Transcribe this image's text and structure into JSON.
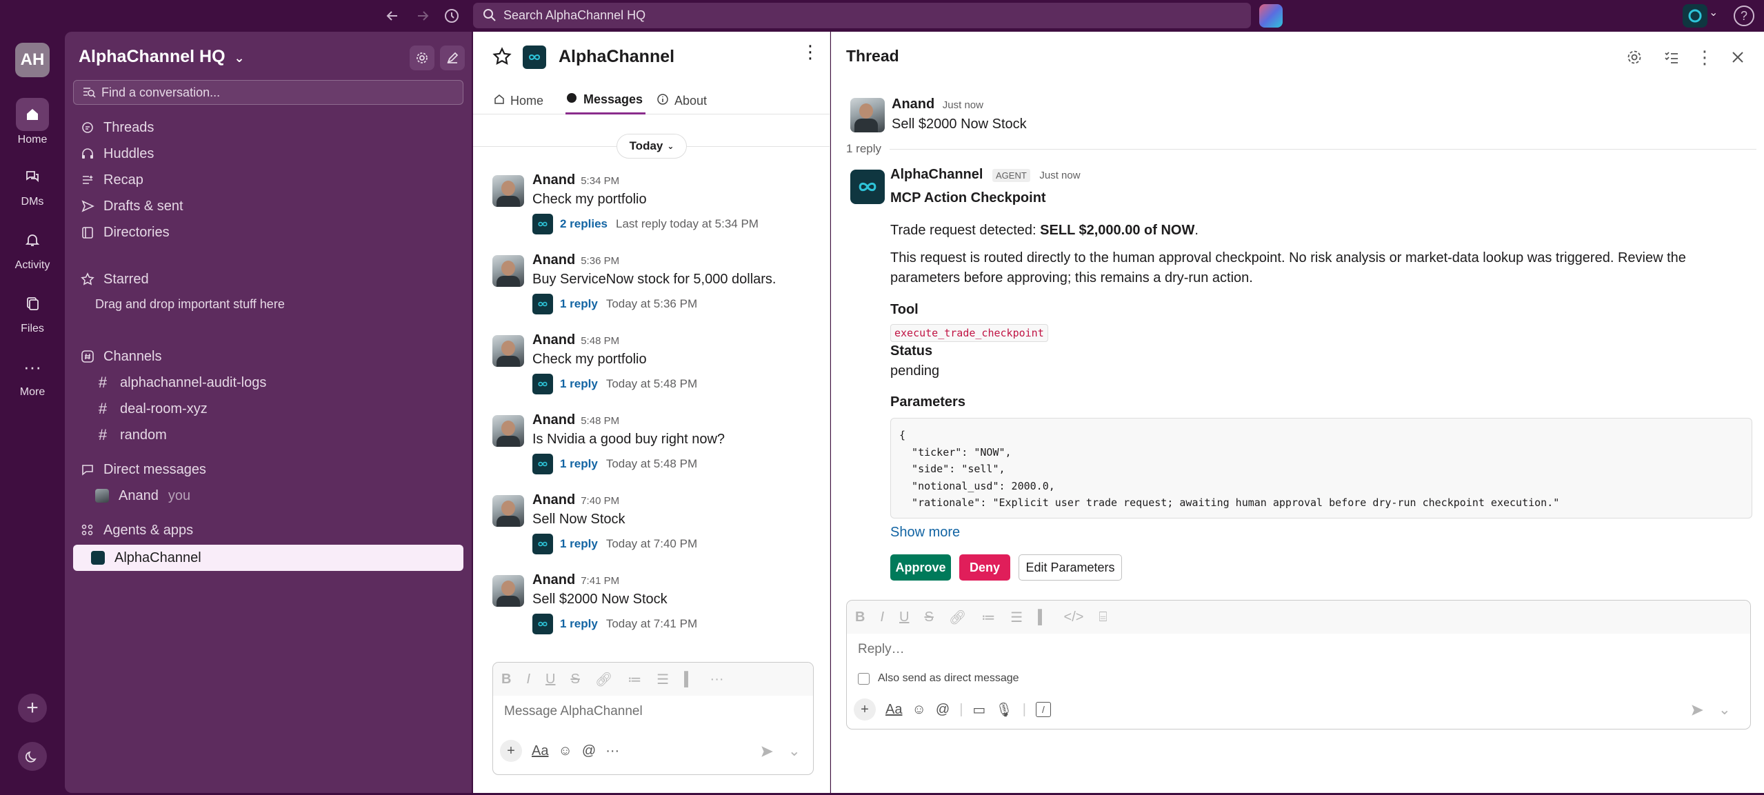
{
  "topbar": {
    "search_placeholder": "Search AlphaChannel HQ"
  },
  "rail": {
    "workspace_initials": "AH",
    "items": [
      {
        "label": "Home"
      },
      {
        "label": "DMs"
      },
      {
        "label": "Activity"
      },
      {
        "label": "Files"
      },
      {
        "label": "More"
      }
    ]
  },
  "sidebar": {
    "workspace_name": "AlphaChannel HQ",
    "find_placeholder": "Find a conversation...",
    "nav": [
      "Threads",
      "Huddles",
      "Recap",
      "Drafts & sent",
      "Directories"
    ],
    "starred_header": "Starred",
    "starred_hint": "Drag and drop important stuff here",
    "channels_header": "Channels",
    "channels": [
      "alphachannel-audit-logs",
      "deal-room-xyz",
      "random"
    ],
    "dm_header": "Direct messages",
    "dm_user": "Anand",
    "dm_you": "you",
    "apps_header": "Agents & apps",
    "active_app": "AlphaChannel"
  },
  "channel": {
    "title": "AlphaChannel",
    "tabs": [
      "Home",
      "Messages",
      "About"
    ],
    "date_pill": "Today",
    "messages": [
      {
        "name": "Anand",
        "time": "5:34 PM",
        "text": "Check my portfolio",
        "replies": "2 replies",
        "reply_meta": "Last reply today at 5:34 PM"
      },
      {
        "name": "Anand",
        "time": "5:36 PM",
        "text": "Buy ServiceNow stock for 5,000 dollars.",
        "replies": "1 reply",
        "reply_meta": "Today at 5:36 PM"
      },
      {
        "name": "Anand",
        "time": "5:48 PM",
        "text": "Check my portfolio",
        "replies": "1 reply",
        "reply_meta": "Today at 5:48 PM"
      },
      {
        "name": "Anand",
        "time": "5:48 PM",
        "text": "Is Nvidia a good buy right now?",
        "replies": "1 reply",
        "reply_meta": "Today at 5:48 PM"
      },
      {
        "name": "Anand",
        "time": "7:40 PM",
        "text": "Sell Now Stock",
        "replies": "1 reply",
        "reply_meta": "Today at 7:40 PM"
      },
      {
        "name": "Anand",
        "time": "7:41 PM",
        "text": "Sell $2000 Now Stock",
        "replies": "1 reply",
        "reply_meta": "Today at 7:41 PM"
      }
    ],
    "composer_placeholder": "Message AlphaChannel"
  },
  "thread": {
    "title": "Thread",
    "parent": {
      "name": "Anand",
      "time": "Just now",
      "text": "Sell $2000 Now Stock"
    },
    "reply_count": "1 reply",
    "reply": {
      "name": "AlphaChannel",
      "tag": "AGENT",
      "time": "Just now",
      "heading": "MCP Action Checkpoint",
      "trade_prefix": "Trade request detected: ",
      "trade_bold": "SELL $2,000.00 of NOW",
      "trade_suffix": ".",
      "paragraph": "This request is routed directly to the human approval checkpoint. No risk analysis or market-data lookup was triggered. Review the parameters before approving; this remains a dry-run action.",
      "tool_label": "Tool",
      "tool_value": "execute_trade_checkpoint",
      "status_label": "Status",
      "status_value": "pending",
      "params_label": "Parameters",
      "params_code": "{\n  \"ticker\": \"NOW\",\n  \"side\": \"sell\",\n  \"notional_usd\": 2000.0,\n  \"rationale\": \"Explicit user trade request; awaiting human approval before dry-run checkpoint execution.\"",
      "show_more": "Show more",
      "approve": "Approve",
      "deny": "Deny",
      "edit": "Edit Parameters"
    },
    "composer_placeholder": "Reply…",
    "also_send": "Also send as direct message"
  },
  "colors": {
    "aubergine": "#3f0e40",
    "sidebar": "#5d2c5e",
    "approve": "#007a5a",
    "deny": "#e01e5a",
    "link": "#1264a3"
  }
}
